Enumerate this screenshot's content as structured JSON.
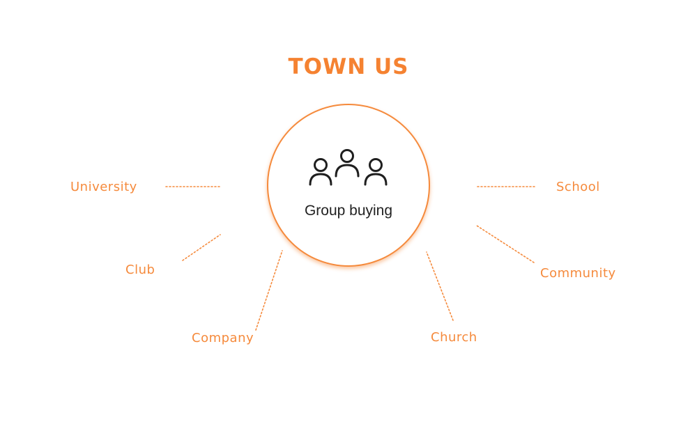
{
  "title": "TOWN US",
  "hub": {
    "label": "Group buying",
    "icon": "group-people-icon"
  },
  "nodes": [
    "University",
    "Club",
    "Company",
    "Church",
    "Community",
    "School"
  ],
  "colors": {
    "accent": "#f58231",
    "hub_text": "#222222",
    "background": "#ffffff"
  }
}
